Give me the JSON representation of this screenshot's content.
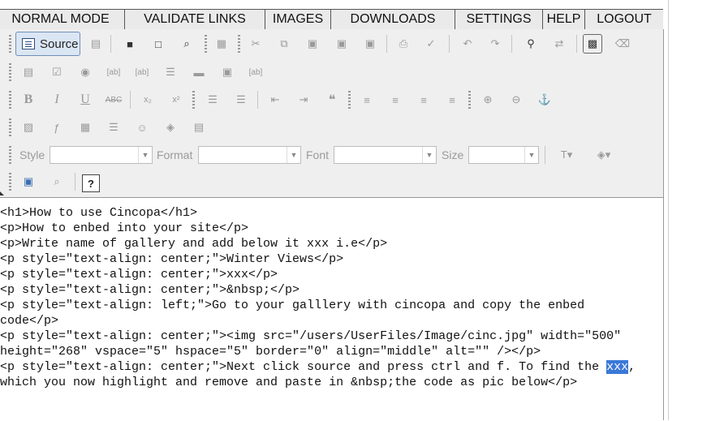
{
  "nav": {
    "items": [
      "NORMAL MODE",
      "VALIDATE LINKS",
      "IMAGES",
      "DOWNLOADS",
      "SETTINGS",
      "HELP",
      "LOGOUT"
    ]
  },
  "toolbar": {
    "source_label": "Source",
    "style_label": "Style",
    "format_label": "Format",
    "font_label": "Font",
    "size_label": "Size",
    "style_value": "",
    "format_value": "",
    "font_value": "",
    "size_value": "",
    "help_label": "?"
  },
  "editor": {
    "lines": [
      "<h1>How to use Cincopa</h1>",
      "<p>How to enbed into your site</p>",
      "<p>Write name of gallery and add below it xxx i.e</p>",
      "<p style=\"text-align: center;\">Winter Views</p>",
      "<p style=\"text-align: center;\">xxx</p>",
      "<p style=\"text-align: center;\">&nbsp;</p>",
      "<p style=\"text-align: left;\">Go to your galllery with cincopa and copy the enbed",
      "code</p>",
      "<p style=\"text-align: center;\"><img src=\"/users/UserFiles/Image/cinc.jpg\" width=\"500\"",
      "height=\"268\" vspace=\"5\" hspace=\"5\" border=\"0\" align=\"middle\" alt=\"\" /></p>",
      "<p style=\"text-align: center;\">Next click source and press ctrl and f. To find the ",
      "which you now highlight and remove and paste in &nbsp;the code as pic below</p>"
    ],
    "selected_text": "xxx",
    "after_selection": ","
  }
}
